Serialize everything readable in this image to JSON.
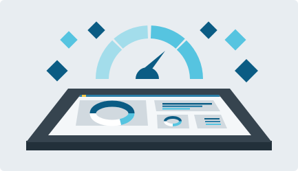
{
  "illustration": {
    "subject": "speedometer-over-dashboard-tablet",
    "icons": [
      "speedometer-icon",
      "tablet-icon",
      "donut-chart-icon",
      "bar-list-icon",
      "diamond-icon"
    ],
    "colors": {
      "background": "#E8EDF1",
      "navy": "#0B5C84",
      "sky": "#56C4E0",
      "pale_sky": "#A3DDEB",
      "tablet_frame": "#36444F",
      "tablet_frame_dark": "#22303A",
      "screen": "#F4F7F9",
      "panel_grey": "#D1D9DF",
      "accent_yellow": "#F2C94C"
    }
  }
}
